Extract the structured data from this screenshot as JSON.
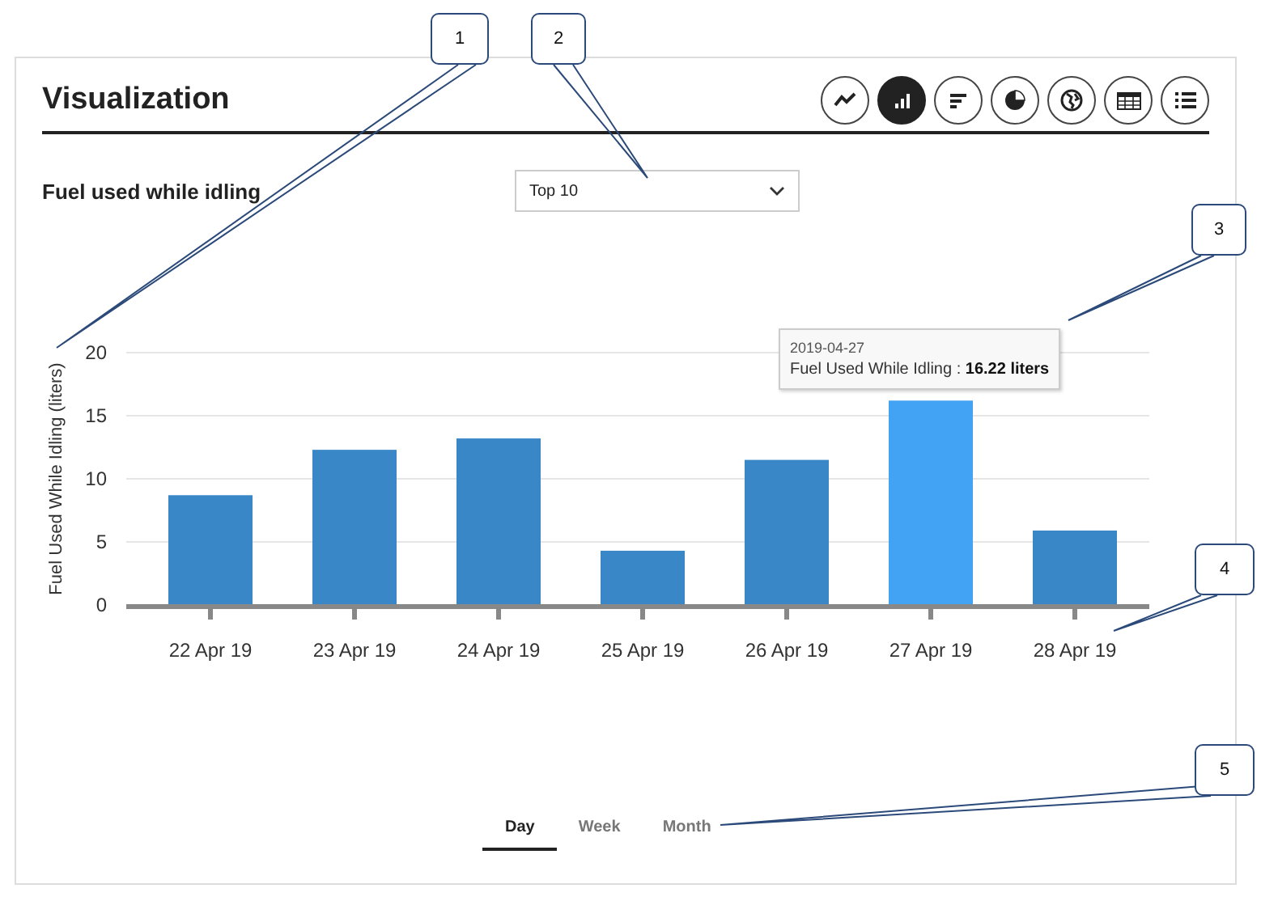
{
  "panel": {
    "title": "Visualization"
  },
  "chart_types": [
    {
      "kind": "line",
      "selected": false
    },
    {
      "kind": "bar",
      "selected": true
    },
    {
      "kind": "hbar",
      "selected": false
    },
    {
      "kind": "pie",
      "selected": false
    },
    {
      "kind": "globe",
      "selected": false
    },
    {
      "kind": "table",
      "selected": false
    },
    {
      "kind": "list",
      "selected": false
    }
  ],
  "subtitle": "Fuel used while idling",
  "dropdown": {
    "value": "Top 10"
  },
  "chart": {
    "chart_data": {
      "type": "bar",
      "ylabel": "Fuel Used While Idling (liters)",
      "categories": [
        "22 Apr 19",
        "23 Apr 19",
        "24 Apr 19",
        "25 Apr 19",
        "26 Apr 19",
        "27 Apr 19",
        "28 Apr 19"
      ],
      "series": [
        {
          "name": "Fuel Used While Idling",
          "color": "#3a87c8",
          "values": [
            8.7,
            12.3,
            13.2,
            4.3,
            11.5,
            16.2,
            5.9
          ]
        }
      ],
      "ylim": [
        0,
        20
      ],
      "yticks": [
        0,
        5,
        10,
        15,
        20
      ],
      "grid": true
    },
    "bars": [
      {
        "hovered": false
      },
      {
        "hovered": false
      },
      {
        "hovered": false
      },
      {
        "hovered": false
      },
      {
        "hovered": false
      },
      {
        "hovered": true
      },
      {
        "hovered": false
      }
    ],
    "tooltip": {
      "date": "2019-04-27",
      "separator": ":",
      "value": "16.22 liters"
    }
  },
  "period_tabs": [
    {
      "label": "Day",
      "selected": true
    },
    {
      "label": "Week",
      "selected": false
    },
    {
      "label": "Month",
      "selected": false
    }
  ],
  "callouts": [
    {
      "label": "1"
    },
    {
      "label": "2"
    },
    {
      "label": "3"
    },
    {
      "label": "4"
    },
    {
      "label": "5"
    }
  ]
}
